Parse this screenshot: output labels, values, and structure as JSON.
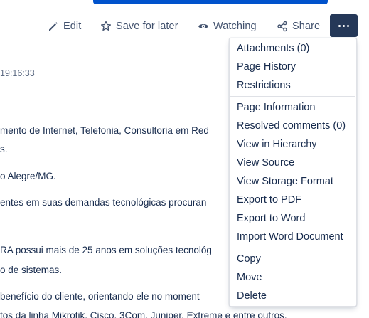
{
  "toolbar": {
    "edit_label": "Edit",
    "save_label": "Save for later",
    "watching_label": "Watching",
    "share_label": "Share"
  },
  "page": {
    "timestamp": "19:16:33",
    "lines": [
      "mento de Internet, Telefonia, Consultoria em Red",
      "s.",
      "o Alegre/MG.",
      "entes em suas demandas tecnológicas procuran",
      "RA possui mais de 25 anos em soluções tecnológ",
      "o de sistemas.",
      "benefício do cliente, orientando ele no moment",
      "tos da linha Mikrotik, Cisco, 3Com, Juniper, Extreme e entre outros."
    ]
  },
  "menu": {
    "group1": [
      "Attachments (0)",
      "Page History",
      "Restrictions"
    ],
    "group2": [
      "Page Information",
      "Resolved comments (0)",
      "View in Hierarchy",
      "View Source",
      "View Storage Format",
      "Export to PDF",
      "Export to Word",
      "Import Word Document"
    ],
    "group3": [
      "Copy",
      "Move",
      "Delete"
    ]
  }
}
